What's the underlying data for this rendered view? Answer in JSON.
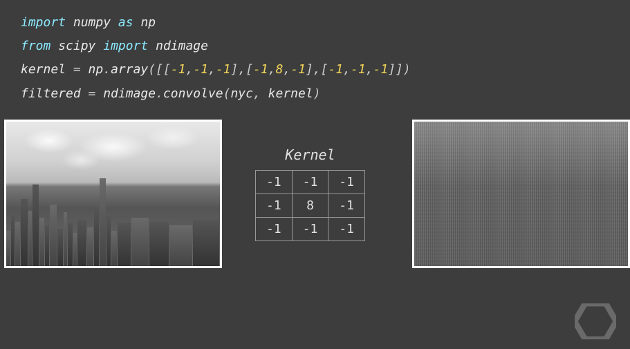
{
  "code": {
    "line1": {
      "kw1": "import",
      "lib": "numpy",
      "kw2": "as",
      "alias": "np"
    },
    "line2": {
      "kw1": "from",
      "lib": "scipy",
      "kw2": "import",
      "mod": "ndimage"
    },
    "line3": {
      "var": "kernel",
      "eq": " = ",
      "obj": "np",
      "dot": ".",
      "fn": "array",
      "args": "([[-1,-1,-1],[-1,8,-1],[-1,-1,-1]])"
    },
    "line3_nums": {
      "a": "-1",
      "b": "-1",
      "c": "-1",
      "d": "-1",
      "e": "8",
      "f": "-1",
      "g": "-1",
      "h": "-1",
      "i": "-1"
    },
    "line4": {
      "var": "filtered",
      "eq": " = ",
      "obj": "ndimage",
      "dot": ".",
      "fn": "convolve",
      "open": "(",
      "arg1": "nyc",
      "comma": ", ",
      "arg2": "kernel",
      "close": ")"
    }
  },
  "kernel": {
    "title": "Kernel",
    "rows": [
      [
        "-1",
        "-1",
        "-1"
      ],
      [
        "-1",
        "8",
        "-1"
      ],
      [
        "-1",
        "-1",
        "-1"
      ]
    ]
  },
  "images": {
    "left_alt": "nyc grayscale photo",
    "right_alt": "nyc filtered edge-detect"
  },
  "chart_data": {
    "type": "table",
    "title": "Kernel",
    "rows": [
      [
        -1,
        -1,
        -1
      ],
      [
        -1,
        8,
        -1
      ],
      [
        -1,
        -1,
        -1
      ]
    ]
  }
}
